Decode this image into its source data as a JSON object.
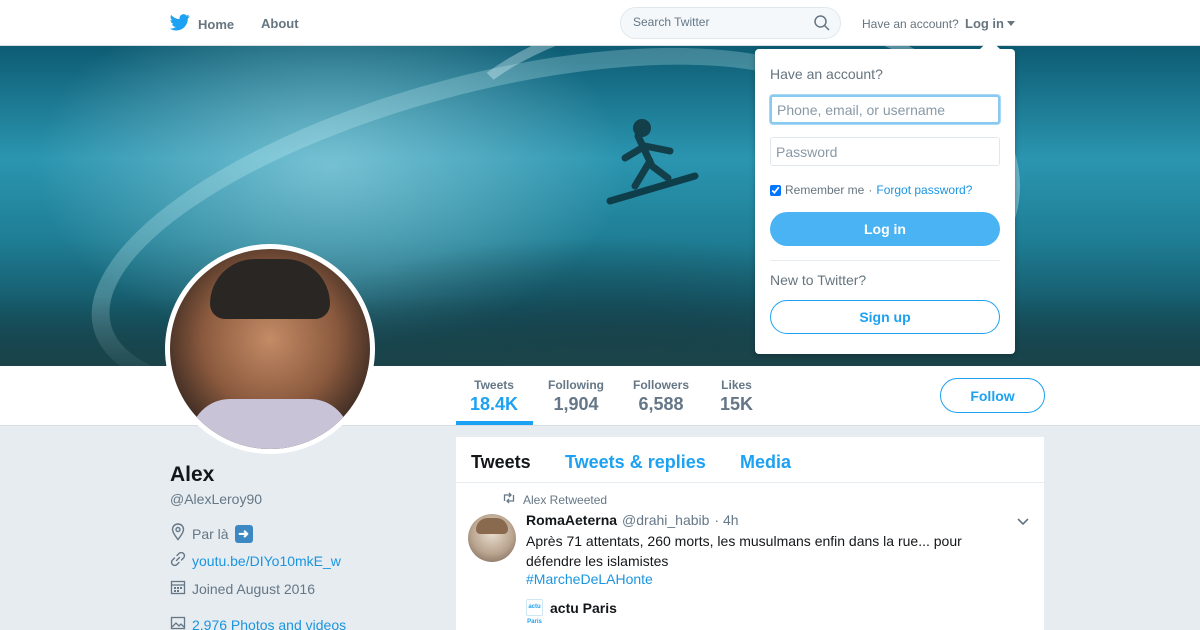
{
  "nav": {
    "home_label": "Home",
    "about_label": "About",
    "search_placeholder": "Search Twitter",
    "have_account_text": "Have an account?",
    "login_label": "Log in"
  },
  "profile": {
    "name": "Alex",
    "handle": "@AlexLeroy90",
    "location": "Par là",
    "location_emoji": "arrow-right",
    "website": "youtu.be/DIYo10mkE_w",
    "joined": "Joined August 2016",
    "photos_videos": "2,976 Photos and videos"
  },
  "stats": [
    {
      "label": "Tweets",
      "value": "18.4K"
    },
    {
      "label": "Following",
      "value": "1,904"
    },
    {
      "label": "Followers",
      "value": "6,588"
    },
    {
      "label": "Likes",
      "value": "15K"
    }
  ],
  "follow_label": "Follow",
  "timeline": {
    "tabs": [
      "Tweets",
      "Tweets & replies",
      "Media"
    ],
    "active_tab": "Tweets",
    "tweet": {
      "retweet_context": "Alex Retweeted",
      "author_name": "RomaAeterna",
      "author_handle": "@drahi_habib",
      "time": "· 4h",
      "text": "Après 71 attentats, 260 morts, les musulmans enfin dans la rue... pour défendre les islamistes",
      "hashtag": "#MarcheDeLAHonte",
      "card_logo": "actu Paris",
      "card_title": "actu Paris"
    }
  },
  "login_dropdown": {
    "title": "Have an account?",
    "username_placeholder": "Phone, email, or username",
    "password_placeholder": "Password",
    "remember_label": "Remember me",
    "separator": "·",
    "forgot_label": "Forgot password?",
    "login_button": "Log in",
    "new_to_twitter": "New to Twitter?",
    "signup_button": "Sign up"
  },
  "colors": {
    "brand_blue": "#1da1f2",
    "link_blue": "#1b95e0",
    "login_button": "#4ab3f4",
    "page_bg": "#e6ecf0"
  }
}
